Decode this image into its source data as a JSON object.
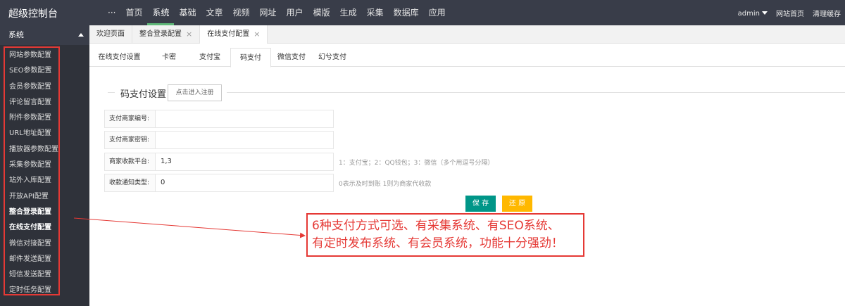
{
  "brand": "超级控制台",
  "top_nav": [
    "···",
    "首页",
    "系统",
    "基础",
    "文章",
    "视频",
    "网址",
    "用户",
    "模版",
    "生成",
    "采集",
    "数据库",
    "应用"
  ],
  "top_nav_active": 2,
  "top_right": {
    "user": "admin",
    "site_home": "网站首页",
    "clear_cache": "清理缓存"
  },
  "sidebar": {
    "header": "系统",
    "items": [
      {
        "label": "网站参数配置",
        "bold": false
      },
      {
        "label": "SEO参数配置",
        "bold": false
      },
      {
        "label": "会员参数配置",
        "bold": false
      },
      {
        "label": "评论留言配置",
        "bold": false
      },
      {
        "label": "附件参数配置",
        "bold": false
      },
      {
        "label": "URL地址配置",
        "bold": false
      },
      {
        "label": "播放器参数配置",
        "bold": false
      },
      {
        "label": "采集参数配置",
        "bold": false
      },
      {
        "label": "站外入库配置",
        "bold": false
      },
      {
        "label": "开放API配置",
        "bold": false
      },
      {
        "label": "整合登录配置",
        "bold": true
      },
      {
        "label": "在线支付配置",
        "bold": true
      },
      {
        "label": "微信对接配置",
        "bold": false
      },
      {
        "label": "邮件发送配置",
        "bold": false
      },
      {
        "label": "短信发送配置",
        "bold": false
      },
      {
        "label": "定时任务配置",
        "bold": false
      }
    ]
  },
  "tabs": [
    {
      "label": "欢迎页面",
      "closable": false,
      "active": false
    },
    {
      "label": "整合登录配置",
      "closable": true,
      "active": false
    },
    {
      "label": "在线支付配置",
      "closable": true,
      "active": true
    }
  ],
  "close_glyph": "×",
  "sub_tabs": [
    "在线支付设置",
    "卡密",
    "支付宝",
    "码支付",
    "微信支付",
    "幻兮支付"
  ],
  "sub_tab_active": 3,
  "section": {
    "title": "码支付设置",
    "register_button": "点击进入注册"
  },
  "form": [
    {
      "label": "支付商家编号:",
      "value": "",
      "hint": ""
    },
    {
      "label": "支付商家密钥:",
      "value": "",
      "hint": ""
    },
    {
      "label": "商家收款平台:",
      "value": "1,3",
      "hint": "1：支付宝；2：QQ钱包；3：微信（多个用逗号分隔）"
    },
    {
      "label": "收款通知类型:",
      "value": "0",
      "hint": "0表示及时到账 1则为商家代收款"
    }
  ],
  "buttons": {
    "save": "保 存",
    "reset": "还 原"
  },
  "callout": {
    "line1": "6种支付方式可选、有采集系统、有SEO系统、",
    "line2": "有定时发布系统、有会员系统，功能十分强劲！"
  },
  "colors": {
    "topbar": "#393d49",
    "sidebar": "#2f323a",
    "active_green": "#5fb878",
    "save": "#009688",
    "reset": "#ffb800",
    "annotation_red": "#e53935"
  }
}
